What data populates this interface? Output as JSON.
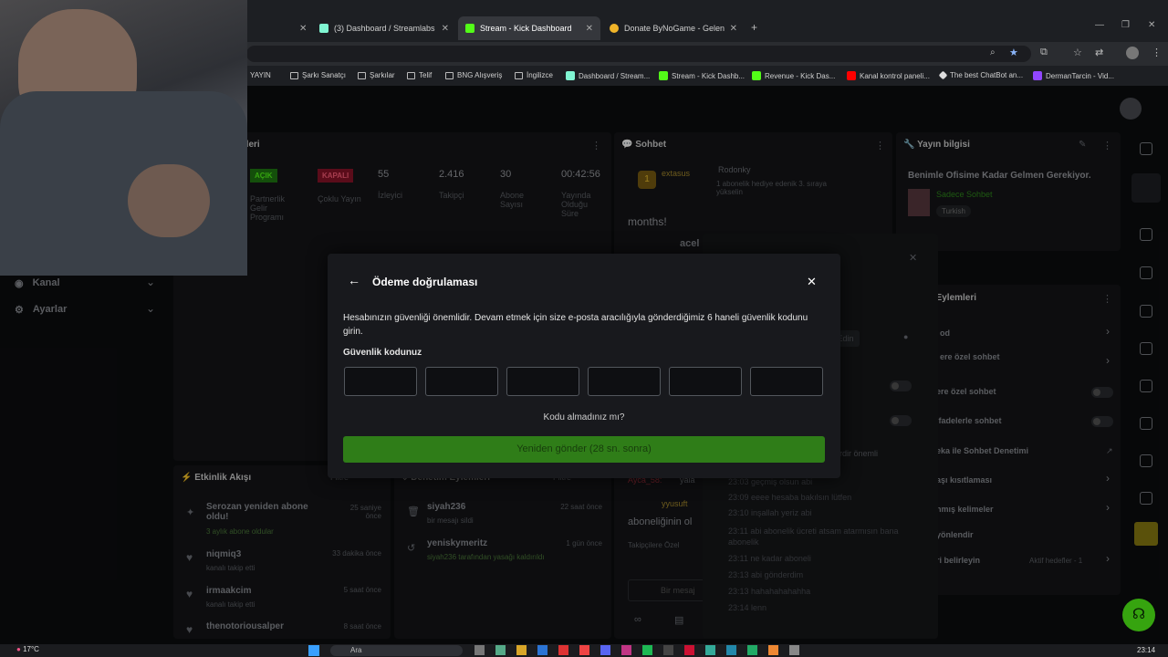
{
  "tabs": [
    {
      "label": "(3) Dashboard / Streamlabs",
      "color": "#80f5d2"
    },
    {
      "label": "Stream - Kick Dashboard",
      "color": "#53fc18"
    },
    {
      "label": "Donate ByNoGame - Gelen/Gid",
      "color": "#f0b429"
    }
  ],
  "bookmarks": [
    "YAYIN",
    "Şarkı Sanatçı",
    "Şarkılar",
    "Telif",
    "BNG Alışveriş",
    "İngilizce",
    "Dashboard / Stream...",
    "Stream - Kick Dashb...",
    "Revenue - Kick Das...",
    "Kanal kontrol paneli...",
    "The best ChatBot an...",
    "DermanTarcin - Vid..."
  ],
  "stats": {
    "panel_title": "tikleri",
    "items": [
      {
        "badge": "AÇIK",
        "label": "Partnerlik Gelir Programı"
      },
      {
        "badge": "KAPALI",
        "label": "Çoklu Yayın"
      },
      {
        "value": "55",
        "label": "İzleyici"
      },
      {
        "value": "2.416",
        "label": "Takipçi"
      },
      {
        "value": "30",
        "label": "Abone Sayısı"
      },
      {
        "value": "00:42:56",
        "label": "Yayında Olduğu Süre"
      }
    ]
  },
  "left_nav": [
    {
      "label": "Kanal"
    },
    {
      "label": "Ayarlar"
    }
  ],
  "chat": {
    "title": "Sohbet",
    "pinned_user": "extasus",
    "pinned_count": "1",
    "gifter": "Rodonky",
    "gift_text": "1 abonelik hediye edenik 3. sıraya yükselin",
    "months_text": "months!",
    "user2": "acel",
    "ayca": "Ayca_58:",
    "ayca_msg": "yala",
    "yyusuf": "yyusuft",
    "abone_text": "aboneliğinin ol",
    "takipciler": "Takipçilere Özel",
    "input_placeholder": "Bir mesaj"
  },
  "stream_info": {
    "title": "Yayın bilgisi",
    "stream_title": "Benimle Ofisime Kadar Gelmen Gerekiyor.",
    "category": "Sadece Sohbet",
    "tag": "Turkish"
  },
  "actions_panel": {
    "title": "l Eylemleri",
    "items": [
      "od",
      "ere özel sohbet",
      "ere özel sohbet",
      "ifadelerle sohbet",
      "eka ile Sohbet Denetimi",
      "aşı kısıtlaması",
      "nmış kelimeler",
      "yönlendir",
      "ri belirleyin"
    ],
    "aktif": "Aktif hedefler - 1",
    "edin": "a Edin"
  },
  "activity": {
    "title": "Etkinlik Akışı",
    "filter": "Filtre",
    "items": [
      {
        "name": "Serozan yeniden abone oldu!",
        "sub": "3 aylık abone oldular",
        "time": "25 saniye önce"
      },
      {
        "name": "niqmiq3",
        "sub": "kanalı takip etti",
        "time": "33 dakika önce"
      },
      {
        "name": "irmaakcim",
        "sub": "kanalı takip etti",
        "time": "5 saat önce"
      },
      {
        "name": "thenotoriousalper",
        "sub": "",
        "time": "8 saat önce"
      }
    ]
  },
  "mod_actions": {
    "title": "Denetim Eylemleri",
    "filter": "Filtre",
    "items": [
      {
        "name": "siyah236",
        "sub": "bir mesajı sildi",
        "time": "22 saat önce"
      },
      {
        "name": "yeniskymeritz",
        "sub": "siyah236 tarafından yasağı kaldırıldı",
        "time": "1 gün önce"
      }
    ]
  },
  "chat_log": [
    {
      "t": "23:03",
      "m": "geçmiş olsun abi"
    },
    {
      "t": "23:09",
      "m": "eeee hesaba bakılsın lütfen"
    },
    {
      "t": "23:10",
      "m": "inşallah yeriz abi"
    },
    {
      "t": "23:11",
      "m": "abi abonelik ücreti atsam atarmısın bana abonelik"
    },
    {
      "t": "23:11",
      "m": "ne kadar aboneli"
    },
    {
      "t": "23:13",
      "m": "abi gönderdim"
    },
    {
      "t": "23:13",
      "m": "hahahahahahha"
    },
    {
      "t": "23:14",
      "m": "lenn"
    }
  ],
  "chat_log_fragment": "rdir önemli",
  "modal": {
    "title": "Ödeme doğrulaması",
    "description": "Hesabınızın güvenliği önemlidir. Devam etmek için size e-posta aracılığıyla gönderdiğimiz 6 haneli güvenlik kodunu girin.",
    "code_label": "Güvenlik kodunuz",
    "code_values": [
      "",
      "",
      "",
      "",
      "",
      ""
    ],
    "no_code": "Kodu almadınız mı?",
    "resend": "Yeniden gönder (28 sn. sonra)"
  },
  "taskbar": {
    "temp": "17°C",
    "search": "Ara",
    "time": "23:14"
  },
  "colors": {
    "accent": "#53fc18",
    "resend_bg": "#2f7d18"
  }
}
